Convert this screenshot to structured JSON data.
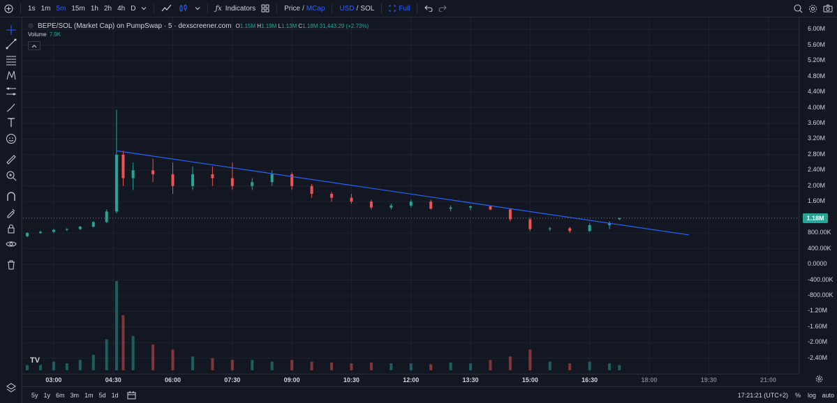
{
  "toolbar": {
    "timeframes": [
      "1s",
      "1m",
      "5m",
      "15m",
      "1h",
      "2h",
      "4h",
      "D"
    ],
    "active_timeframe": "5m",
    "indicators_label": "Indicators",
    "price_label": "Price",
    "mcap_label": "MCap",
    "usd_label": "USD",
    "sol_label": "SOL",
    "slash": "/",
    "full_label": "Full"
  },
  "legend": {
    "title": "BEPE/SOL (Market Cap) on PumpSwap · 5 · dexscreener.com",
    "o_label": "O",
    "o_value": "1.15M",
    "h_label": "H",
    "h_value": "1.19M",
    "l_label": "L",
    "l_value": "1.13M",
    "c_label": "C",
    "c_value": "1.18M",
    "change": "31,443.29 (+2.73%)",
    "volume_label": "Volume",
    "volume_value": "7.9K",
    "logo": "TV"
  },
  "price_axis": {
    "ticks": [
      "6.00M",
      "5.60M",
      "5.20M",
      "4.80M",
      "4.40M",
      "4.00M",
      "3.60M",
      "3.20M",
      "2.80M",
      "2.40M",
      "2.00M",
      "1.60M",
      "800.00K",
      "400.00K",
      "0.0000",
      "-400.00K",
      "-800.00K",
      "-1.20M",
      "-1.60M",
      "-2.00M",
      "-2.40M"
    ],
    "current_price": "1.18M"
  },
  "time_axis": {
    "ticks": [
      "03:00",
      "04:30",
      "06:00",
      "07:30",
      "09:00",
      "10:30",
      "12:00",
      "13:30",
      "15:00",
      "16:30",
      "18:00",
      "19:30",
      "21:00"
    ]
  },
  "bottom_bar": {
    "ranges": [
      "5y",
      "1y",
      "6m",
      "3m",
      "1m",
      "5d",
      "1d"
    ],
    "clock": "17:21:21 (UTC+2)",
    "percent": "%",
    "log": "log",
    "auto": "auto"
  },
  "colors": {
    "background": "#131722",
    "up": "#26a69a",
    "down": "#ef5350",
    "trendline": "#2962ff",
    "accent": "#2962ff"
  },
  "chart_data": {
    "type": "candlestick",
    "symbol": "BEPE/SOL",
    "interval": "5",
    "y_unit": "Market Cap (USD)",
    "ylim": [
      -2600000,
      6200000
    ],
    "x_range": [
      "02:00",
      "22:00"
    ],
    "series": [
      {
        "name": "Price",
        "ohlc": [
          [
            "02:20",
            720000,
            820000,
            690000,
            800000
          ],
          [
            "02:40",
            800000,
            860000,
            780000,
            830000
          ],
          [
            "03:00",
            830000,
            900000,
            800000,
            880000
          ],
          [
            "03:20",
            880000,
            920000,
            850000,
            900000
          ],
          [
            "03:40",
            900000,
            980000,
            880000,
            960000
          ],
          [
            "04:00",
            960000,
            1100000,
            940000,
            1080000
          ],
          [
            "04:20",
            1080000,
            1400000,
            1050000,
            1350000
          ],
          [
            "04:35",
            1350000,
            3950000,
            1300000,
            2800000
          ],
          [
            "04:45",
            2800000,
            2900000,
            2000000,
            2200000
          ],
          [
            "05:00",
            2200000,
            2600000,
            1900000,
            2400000
          ],
          [
            "05:30",
            2400000,
            2700000,
            2100000,
            2300000
          ],
          [
            "06:00",
            2300000,
            2600000,
            1800000,
            2000000
          ],
          [
            "06:30",
            2000000,
            2500000,
            1900000,
            2300000
          ],
          [
            "07:00",
            2300000,
            2500000,
            2000000,
            2200000
          ],
          [
            "07:30",
            2200000,
            2600000,
            1900000,
            2000000
          ],
          [
            "08:00",
            2000000,
            2200000,
            1900000,
            2100000
          ],
          [
            "08:30",
            2100000,
            2400000,
            2000000,
            2300000
          ],
          [
            "09:00",
            2300000,
            2350000,
            1900000,
            2000000
          ],
          [
            "09:30",
            2000000,
            2050000,
            1700000,
            1800000
          ],
          [
            "10:00",
            1800000,
            1850000,
            1600000,
            1700000
          ],
          [
            "10:30",
            1700000,
            1800000,
            1550000,
            1600000
          ],
          [
            "11:00",
            1600000,
            1650000,
            1400000,
            1450000
          ],
          [
            "11:30",
            1450000,
            1550000,
            1400000,
            1500000
          ],
          [
            "12:00",
            1500000,
            1650000,
            1450000,
            1600000
          ],
          [
            "12:30",
            1600000,
            1650000,
            1400000,
            1420000
          ],
          [
            "13:00",
            1420000,
            1500000,
            1350000,
            1450000
          ],
          [
            "13:30",
            1450000,
            1500000,
            1380000,
            1480000
          ],
          [
            "14:00",
            1480000,
            1500000,
            1380000,
            1400000
          ],
          [
            "14:30",
            1400000,
            1420000,
            1100000,
            1150000
          ],
          [
            "15:00",
            1150000,
            1200000,
            850000,
            900000
          ],
          [
            "15:30",
            900000,
            950000,
            850000,
            920000
          ],
          [
            "16:00",
            920000,
            960000,
            800000,
            850000
          ],
          [
            "16:30",
            850000,
            1050000,
            830000,
            1000000
          ],
          [
            "17:00",
            1000000,
            1100000,
            900000,
            1050000
          ],
          [
            "17:15",
            1150000,
            1190000,
            1130000,
            1180000
          ]
        ]
      },
      {
        "name": "Volume",
        "values": [
          30000,
          40000,
          50000,
          40000,
          60000,
          90000,
          180000,
          520000,
          320000,
          200000,
          150000,
          120000,
          80000,
          70000,
          60000,
          60000,
          50000,
          60000,
          50000,
          45000,
          40000,
          45000,
          40000,
          40000,
          35000,
          45000,
          40000,
          60000,
          80000,
          120000,
          50000,
          40000,
          50000,
          40000,
          30000
        ]
      }
    ],
    "trendline": {
      "from": [
        "04:35",
        2900000
      ],
      "to": [
        "19:00",
        750000
      ]
    },
    "current_price_line": 1180000
  }
}
